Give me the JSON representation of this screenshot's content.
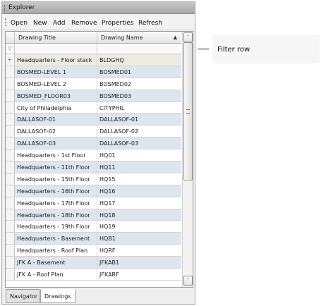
{
  "window": {
    "title": "Explorer"
  },
  "toolbar": {
    "buttons": [
      "Open",
      "New",
      "Add",
      "Remove",
      "Properties",
      "Refresh"
    ]
  },
  "grid": {
    "columns": [
      "Drawing Title",
      "Drawing Name"
    ],
    "sort_indicator": "▲",
    "filter_icon": "▽",
    "rows": [
      [
        "Headquarters - Floor stack",
        "BLDGHQ"
      ],
      [
        "BOSMED-LEVEL 1",
        "BOSMED01"
      ],
      [
        "BOSMED-LEVEL 2",
        "BOSMED02"
      ],
      [
        "BOSMED_FLOOR03",
        "BOSMED03"
      ],
      [
        "City of Philadelphia",
        "CITYPHIL"
      ],
      [
        "DALLASOF-01",
        "DALLASOF-01"
      ],
      [
        "DALLASOF-02",
        "DALLASOF-02"
      ],
      [
        "DALLASOF-03",
        "DALLASOF-03"
      ],
      [
        "Headquarters - 1st Floor",
        "HQ01"
      ],
      [
        "Headquarters - 11th Floor",
        "HQ11"
      ],
      [
        "Headquarters - 15th Floor",
        "HQ15"
      ],
      [
        "Headquarters - 16th Floor",
        "HQ16"
      ],
      [
        "Headquarters - 17th Floor",
        "HQ17"
      ],
      [
        "Headquarters - 18th Floor",
        "HQ18"
      ],
      [
        "Headquarters - 19th Floor",
        "HQ19"
      ],
      [
        "Headquarters - Basement",
        "HQB1"
      ],
      [
        "Headquarters - Roof Plan",
        "HQRF"
      ],
      [
        "JFK A - Basement",
        "JFKAB1"
      ],
      [
        "JFK A - Roof Plan",
        "JFKARF"
      ]
    ],
    "current_row_marker": "▸"
  },
  "tabs": [
    "Navigator",
    "Drawings"
  ],
  "active_tab": "Drawings",
  "callout": {
    "label": "Filter row"
  },
  "colors": {
    "alt_row": "#dde6ee",
    "active_row": "#ecebe3",
    "title_bar": "#b8b8b8"
  }
}
